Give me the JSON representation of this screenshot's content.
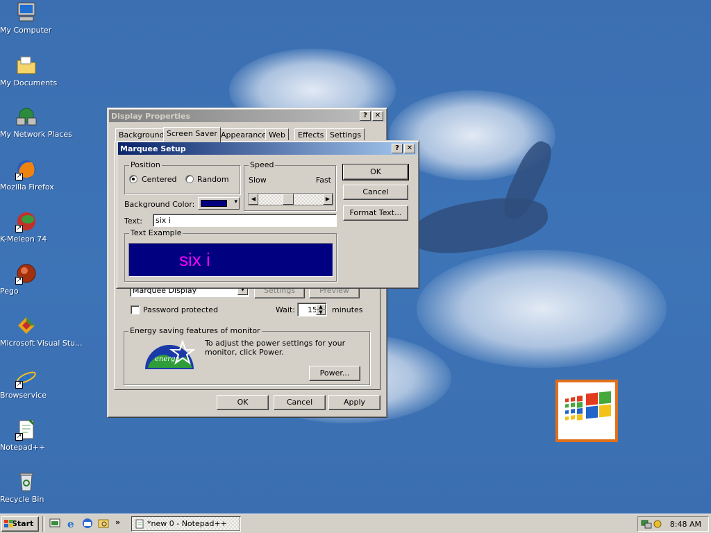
{
  "desktop": {
    "icons": [
      {
        "label": "My Computer",
        "icon": "my-computer-icon"
      },
      {
        "label": "My Documents",
        "icon": "my-documents-icon"
      },
      {
        "label": "My Network Places",
        "icon": "network-places-icon"
      },
      {
        "label": "Mozilla Firefox",
        "icon": "firefox-icon"
      },
      {
        "label": "K-Meleon 74",
        "icon": "kmeleon-icon"
      },
      {
        "label": "Pego",
        "icon": "pego-icon"
      },
      {
        "label": "Microsoft Visual Stu...",
        "icon": "visual-studio-icon"
      },
      {
        "label": "Browservice",
        "icon": "ie-icon"
      },
      {
        "label": "Notepad++",
        "icon": "notepadpp-icon"
      },
      {
        "label": "Recycle Bin",
        "icon": "recycle-bin-icon"
      }
    ]
  },
  "display_properties": {
    "title": "Display Properties",
    "tabs": [
      "Background",
      "Screen Saver",
      "Appearance",
      "Web",
      "Effects",
      "Settings"
    ],
    "active_tab": "Screen Saver",
    "screensaver_select": "Marquee Display",
    "settings_label": "Settings",
    "preview_label": "Preview",
    "password_label": "Password protected",
    "wait_label": "Wait:",
    "wait_value": "15",
    "minutes_label": "minutes",
    "energy_group": "Energy saving features of monitor",
    "energy_text": "To adjust the power settings for your monitor, click Power.",
    "power_button": "Power...",
    "ok": "OK",
    "cancel": "Cancel",
    "apply": "Apply",
    "help_btn": "?",
    "close_btn": "✕"
  },
  "marquee_setup": {
    "title": "Marquee Setup",
    "position_group": "Position",
    "centered": "Centered",
    "random": "Random",
    "speed_group": "Speed",
    "slow": "Slow",
    "fast": "Fast",
    "speed_level": 0.45,
    "background_color_label": "Background Color:",
    "background_color": "#000080",
    "text_label": "Text:",
    "text_value": "six i",
    "example_group": "Text Example",
    "example_text": "six i",
    "example_text_color": "#ff00ff",
    "ok": "OK",
    "cancel": "Cancel",
    "format_text": "Format Text...",
    "help_btn": "?",
    "close_btn": "✕"
  },
  "taskbar": {
    "start": "Start",
    "task": "*new  0 - Notepad++",
    "clock": "8:48 AM"
  }
}
